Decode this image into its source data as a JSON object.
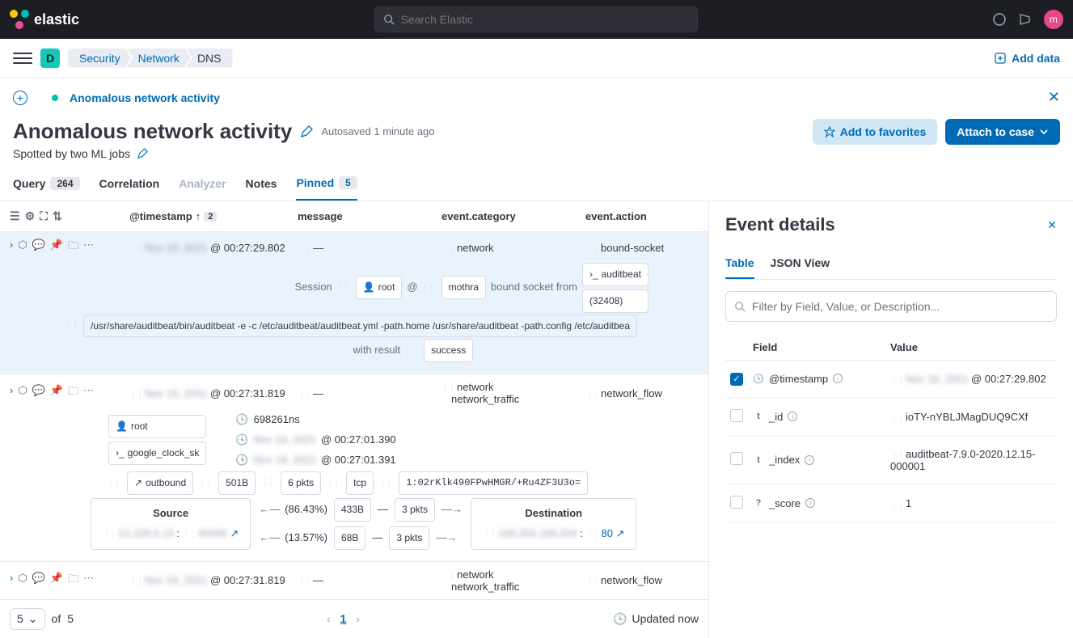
{
  "topnav": {
    "brand": "elastic",
    "search_placeholder": "Search Elastic",
    "avatar_letter": "m"
  },
  "breadcrumbs": {
    "space_letter": "D",
    "items": [
      "Security",
      "Network",
      "DNS"
    ],
    "add_data": "Add data"
  },
  "banner": {
    "timeline_name": "Anomalous network activity"
  },
  "header": {
    "title": "Anomalous network activity",
    "autosave": "Autosaved 1 minute ago",
    "subtitle": "Spotted by two ML jobs",
    "fav_label": "Add to favorites",
    "attach_label": "Attach to case"
  },
  "tabs": {
    "query": "Query",
    "query_count": "264",
    "correlation": "Correlation",
    "analyzer": "Analyzer",
    "notes": "Notes",
    "pinned": "Pinned",
    "pinned_count": "5"
  },
  "columns": {
    "ts": "@timestamp",
    "ts_sort": "2",
    "msg": "message",
    "cat": "event.category",
    "act": "event.action"
  },
  "rows": [
    {
      "ts_hidden": "Nov 19, 2021",
      "ts_rest": "@ 00:27:29.802",
      "msg": "—",
      "cats": [
        "network"
      ],
      "act": "bound-socket",
      "body": {
        "session_label": "Session",
        "user": "root",
        "at": "@",
        "host": "mothra",
        "desc": "bound socket from",
        "proc": "auditbeat",
        "pid": "(32408)",
        "cmd": "/usr/share/auditbeat/bin/auditbeat -e -c /etc/auditbeat/auditbeat.yml -path.home /usr/share/auditbeat -path.config /etc/auditbea",
        "result_label": "with result",
        "result": "success"
      }
    },
    {
      "ts_hidden": "Nov 19, 2021",
      "ts_rest": "@ 00:27:31.819",
      "msg": "—",
      "cats": [
        "network",
        "network_traffic"
      ],
      "act": "network_flow",
      "body2": {
        "user": "root",
        "proc": "google_clock_sk",
        "dur": "698261ns",
        "t1_hidden": "Nov 19, 2021",
        "t1_rest": "@ 00:27:01.390",
        "t2_hidden": "Nov 19, 2021",
        "t2_rest": "@ 00:27:01.391",
        "dir": "outbound",
        "bytes": "501B",
        "pkts": "6 pkts",
        "transport": "tcp",
        "hash": "1:02rKlk490FPwHMGR/+Ru4ZF3U3o=",
        "src_label": "Source",
        "src_ip": "10.128.0.13",
        "src_port": "45006",
        "pct1": "(86.43%)",
        "b1": "433B",
        "p1": "3 pkts",
        "pct2": "(13.57%)",
        "b2": "68B",
        "p2": "3 pkts",
        "dst_label": "Destination",
        "dst_ip": "169.254.169.254",
        "dst_port": "80"
      }
    },
    {
      "ts_hidden": "Nov 19, 2021",
      "ts_rest": "@ 00:27:31.819",
      "msg": "—",
      "cats": [
        "network",
        "network_traffic"
      ],
      "act": "network_flow"
    }
  ],
  "footer": {
    "page_size": "5",
    "of_label": "of",
    "total": "5",
    "page": "1",
    "updated": "Updated now"
  },
  "details": {
    "title": "Event details",
    "tab_table": "Table",
    "tab_json": "JSON View",
    "filter_placeholder": "Filter by Field, Value, or Description...",
    "head_field": "Field",
    "head_value": "Value",
    "rows": [
      {
        "checked": true,
        "type": "clock",
        "field": "@timestamp",
        "value_hidden": "Nov 19, 2021",
        "value_rest": "@ 00:27:29.802"
      },
      {
        "checked": false,
        "type": "t",
        "field": "_id",
        "value": "ioTY-nYBLJMagDUQ9CXf"
      },
      {
        "checked": false,
        "type": "t",
        "field": "_index",
        "value": "auditbeat-7.9.0-2020.12.15-000001"
      },
      {
        "checked": false,
        "type": "q",
        "field": "_score",
        "value": "1"
      }
    ]
  }
}
